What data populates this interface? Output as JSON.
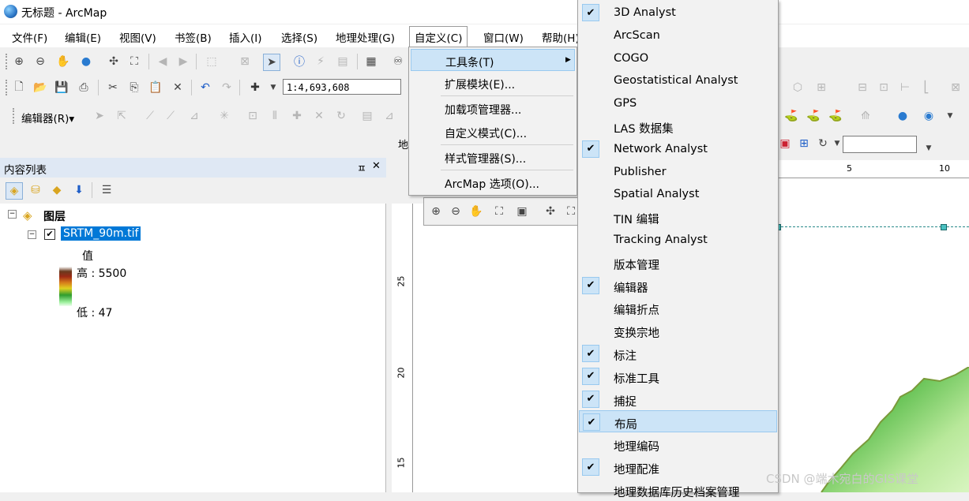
{
  "window": {
    "title": "无标题 - ArcMap"
  },
  "menubar": {
    "items": [
      "文件(F)",
      "编辑(E)",
      "视图(V)",
      "书签(B)",
      "插入(I)",
      "选择(S)",
      "地理处理(G)",
      "自定义(C)",
      "窗口(W)",
      "帮助(H)"
    ]
  },
  "toolbar": {
    "scale_value": "1:4,693,608",
    "editor_label": "编辑器(R)▾",
    "ruler_h_5": "5",
    "ruler_h_10": "10",
    "ruler_v_25": "25",
    "ruler_v_20": "20",
    "ruler_v_15": "15",
    "small_tab_label": "地"
  },
  "toc": {
    "title": "内容列表",
    "pin": "ㅍ",
    "close": "✕",
    "root_layer": "图层",
    "layer_name": "SRTM_90m.tif",
    "legend_title": "值",
    "legend_high": "高 : 5500",
    "legend_low": "低 : 47"
  },
  "customize_menu": {
    "items": [
      {
        "label": "工具条(T)",
        "highlighted": true,
        "submenu": true
      },
      {
        "label": "扩展模块(E)..."
      },
      {
        "label": "加载项管理器..."
      },
      {
        "label": "自定义模式(C)..."
      },
      {
        "label": "样式管理器(S)..."
      },
      {
        "label": "ArcMap 选项(O)..."
      }
    ],
    "submenu_arrow": "▶"
  },
  "toolbars_submenu": {
    "items": [
      {
        "label": "3D Analyst",
        "checked": true
      },
      {
        "label": "ArcScan",
        "checked": false
      },
      {
        "label": "COGO",
        "checked": false
      },
      {
        "label": "Geostatistical Analyst",
        "checked": false
      },
      {
        "label": "GPS",
        "checked": false
      },
      {
        "label": "LAS 数据集",
        "checked": false
      },
      {
        "label": "Network Analyst",
        "checked": true
      },
      {
        "label": "Publisher",
        "checked": false
      },
      {
        "label": "Spatial Analyst",
        "checked": false
      },
      {
        "label": "TIN 编辑",
        "checked": false
      },
      {
        "label": "Tracking Analyst",
        "checked": false
      },
      {
        "label": "版本管理",
        "checked": false
      },
      {
        "label": "编辑器",
        "checked": true
      },
      {
        "label": "编辑折点",
        "checked": false
      },
      {
        "label": "变换宗地",
        "checked": false
      },
      {
        "label": "标注",
        "checked": true
      },
      {
        "label": "标准工具",
        "checked": true
      },
      {
        "label": "捕捉",
        "checked": true
      },
      {
        "label": "布局",
        "checked": true,
        "highlighted": true
      },
      {
        "label": "地理编码",
        "checked": false
      },
      {
        "label": "地理配准",
        "checked": true
      },
      {
        "label": "地理数据库历史档案管理",
        "checked": false
      }
    ],
    "check_glyph": "✔"
  },
  "watermark": "CSDN @端木宛白的GIS课堂",
  "colors": {
    "menu_highlight": "#cce4f7",
    "menu_highlight_border": "#99c9ef",
    "layer_selected": "#0078d7",
    "toc_header": "#dfe8f4"
  }
}
